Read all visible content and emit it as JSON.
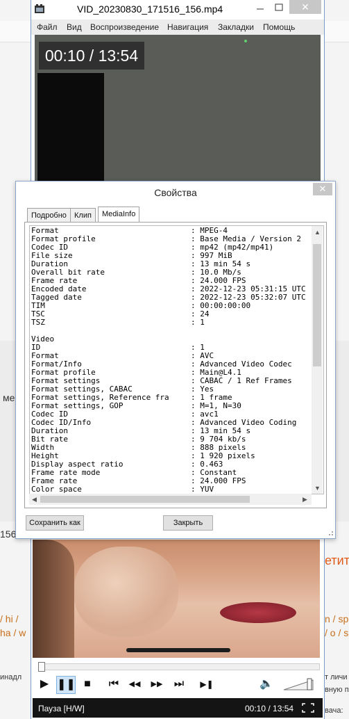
{
  "background": {
    "left_fragments": [
      "ме",
      "156"
    ],
    "bottom_left_fragments": [
      "/ hi /",
      "ha / w",
      "инадл"
    ],
    "right_fragments": [
      "етит",
      "n / sp",
      "/ o / s",
      "т личи",
      "вную п",
      "вача:"
    ]
  },
  "player": {
    "title": "VID_20230830_171516_156.mp4",
    "menu": [
      "Файл",
      "Вид",
      "Воспроизведение",
      "Навигация",
      "Закладки",
      "Помощь"
    ],
    "time_overlay": "00:10 / 13:54",
    "status_left": "Пауза [H/W]",
    "status_right": "00:10 / 13:54",
    "close_glyph": "✕",
    "controls": [
      {
        "name": "play-button",
        "glyph": "▶"
      },
      {
        "name": "pause-button",
        "glyph": "❚❚"
      },
      {
        "name": "stop-button",
        "glyph": "■"
      },
      {
        "name": "skip-back-button",
        "glyph": "⏮"
      },
      {
        "name": "rewind-button",
        "glyph": "◀◀"
      },
      {
        "name": "forward-button",
        "glyph": "▶▶"
      },
      {
        "name": "skip-forward-button",
        "glyph": "⏭"
      },
      {
        "name": "frame-step-button",
        "glyph": "▶❚"
      },
      {
        "name": "volume-icon",
        "glyph": "🔈"
      }
    ]
  },
  "dialog": {
    "title": "Свойства",
    "close_glyph": "✕",
    "tabs": [
      "Подробно",
      "Клип",
      "MediaInfo"
    ],
    "active_tab": "MediaInfo",
    "save_label": "Сохранить как",
    "close_label": "Закрыть",
    "info_rows": [
      [
        "Format",
        "MPEG-4"
      ],
      [
        "Format profile",
        "Base Media / Version 2"
      ],
      [
        "Codec ID",
        "mp42 (mp42/mp41)"
      ],
      [
        "File size",
        "997 MiB"
      ],
      [
        "Duration",
        "13 min 54 s"
      ],
      [
        "Overall bit rate",
        "10.0 Mb/s"
      ],
      [
        "Frame rate",
        "24.000 FPS"
      ],
      [
        "Encoded date",
        "2022-12-23 05:31:15 UTC"
      ],
      [
        "Tagged date",
        "2022-12-23 05:32:07 UTC"
      ],
      [
        "TIM",
        "00:00:00:00"
      ],
      [
        "TSC",
        "24"
      ],
      [
        "TSZ",
        "1"
      ],
      [
        "",
        ""
      ],
      [
        "Video",
        ""
      ],
      [
        "ID",
        "1"
      ],
      [
        "Format",
        "AVC"
      ],
      [
        "Format/Info",
        "Advanced Video Codec"
      ],
      [
        "Format profile",
        "Main@L4.1"
      ],
      [
        "Format settings",
        "CABAC / 1 Ref Frames"
      ],
      [
        "Format settings, CABAC",
        "Yes"
      ],
      [
        "Format settings, Reference fra",
        "1 frame"
      ],
      [
        "Format settings, GOP",
        "M=1, N=30"
      ],
      [
        "Codec ID",
        "avc1"
      ],
      [
        "Codec ID/Info",
        "Advanced Video Coding"
      ],
      [
        "Duration",
        "13 min 54 s"
      ],
      [
        "Bit rate",
        "9 704 kb/s"
      ],
      [
        "Width",
        "888 pixels"
      ],
      [
        "Height",
        "1 920 pixels"
      ],
      [
        "Display aspect ratio",
        "0.463"
      ],
      [
        "Frame rate mode",
        "Constant"
      ],
      [
        "Frame rate",
        "24.000 FPS"
      ],
      [
        "Color space",
        "YUV"
      ]
    ]
  }
}
